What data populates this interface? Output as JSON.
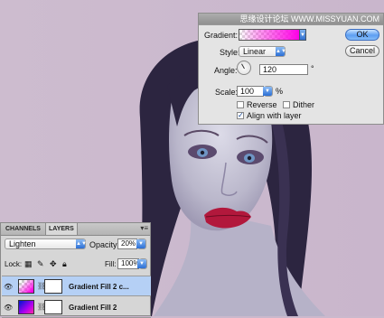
{
  "watermark": "思缘设计论坛 WWW.MISSYUAN.COM",
  "dialog": {
    "gradient_label": "Gradient:",
    "style_label": "Style:",
    "style_value": "Linear",
    "angle_label": "Angle:",
    "angle_value": "120",
    "angle_unit": "°",
    "scale_label": "Scale:",
    "scale_value": "100",
    "scale_unit": "%",
    "reverse_label": "Reverse",
    "reverse_checked": false,
    "dither_label": "Dither",
    "dither_checked": false,
    "align_label": "Align with layer",
    "align_checked": true,
    "ok_label": "OK",
    "cancel_label": "Cancel",
    "gradient_colors": [
      "#ff00e6",
      "transparent"
    ]
  },
  "layers_panel": {
    "tabs": [
      {
        "label": "CHANNELS",
        "active": false
      },
      {
        "label": "LAYERS",
        "active": true
      }
    ],
    "blend_mode": "Lighten",
    "opacity_label": "Opacity:",
    "opacity_value": "20%",
    "lock_label": "Lock:",
    "fill_label": "Fill:",
    "fill_value": "100%",
    "layers": [
      {
        "name": "Gradient Fill 2 c...",
        "selected": true
      },
      {
        "name": "Gradient Fill 2",
        "selected": false
      }
    ]
  },
  "colors": {
    "background": "#cbb9cd",
    "selection": "#b5d0f5",
    "ok_button": "#5c9ef2",
    "lips": "#b2183c"
  }
}
